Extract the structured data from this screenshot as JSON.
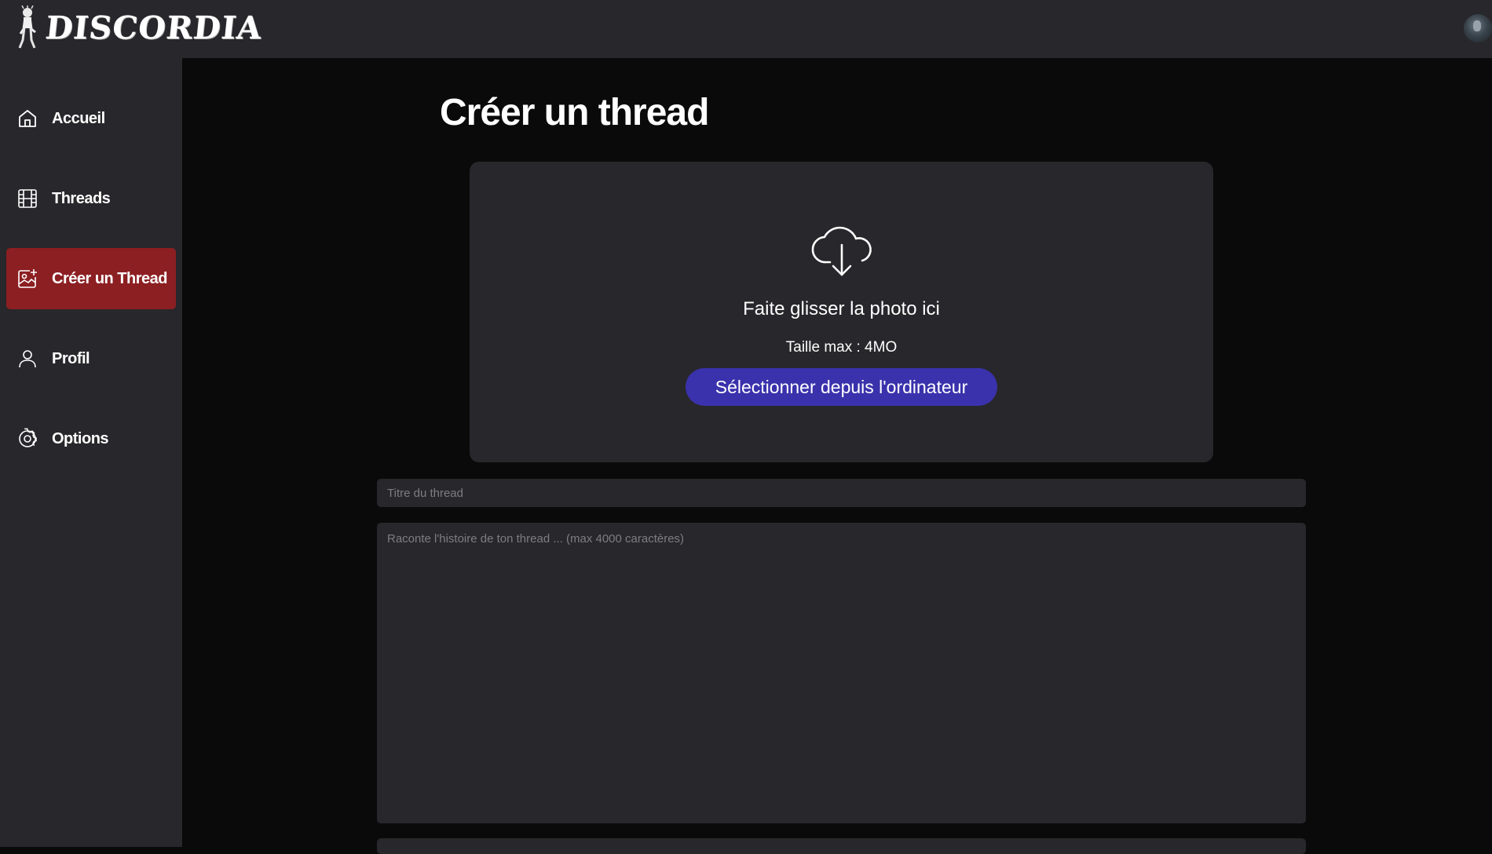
{
  "app": {
    "brand": "DISCORDIA",
    "logo_icon": "zombie-mascot-icon",
    "avatar_icon": "user-avatar"
  },
  "sidebar": {
    "items": [
      {
        "label": "Accueil",
        "icon": "home-icon",
        "active": false
      },
      {
        "label": "Threads",
        "icon": "film-icon",
        "active": false
      },
      {
        "label": "Créer un Thread",
        "icon": "image-add-icon",
        "active": true
      },
      {
        "label": "Profil",
        "icon": "user-icon",
        "active": false
      },
      {
        "label": "Options",
        "icon": "gear-icon",
        "active": false
      }
    ]
  },
  "main": {
    "title": "Créer un thread",
    "dropzone": {
      "icon": "cloud-download-icon",
      "text": "Faite glisser la photo ici",
      "size_limit": "Taille max : 4MO",
      "button_label": "Sélectionner depuis l'ordinateur"
    },
    "title_input": {
      "placeholder": "Titre du thread",
      "value": ""
    },
    "story_input": {
      "placeholder": "Raconte l'histoire de ton thread ... (max 4000 caractères)",
      "value": ""
    }
  },
  "colors": {
    "background": "#0b0a0a",
    "panel": "#28272b",
    "active_nav": "#8c1f22",
    "primary_button": "#3a32ac"
  }
}
